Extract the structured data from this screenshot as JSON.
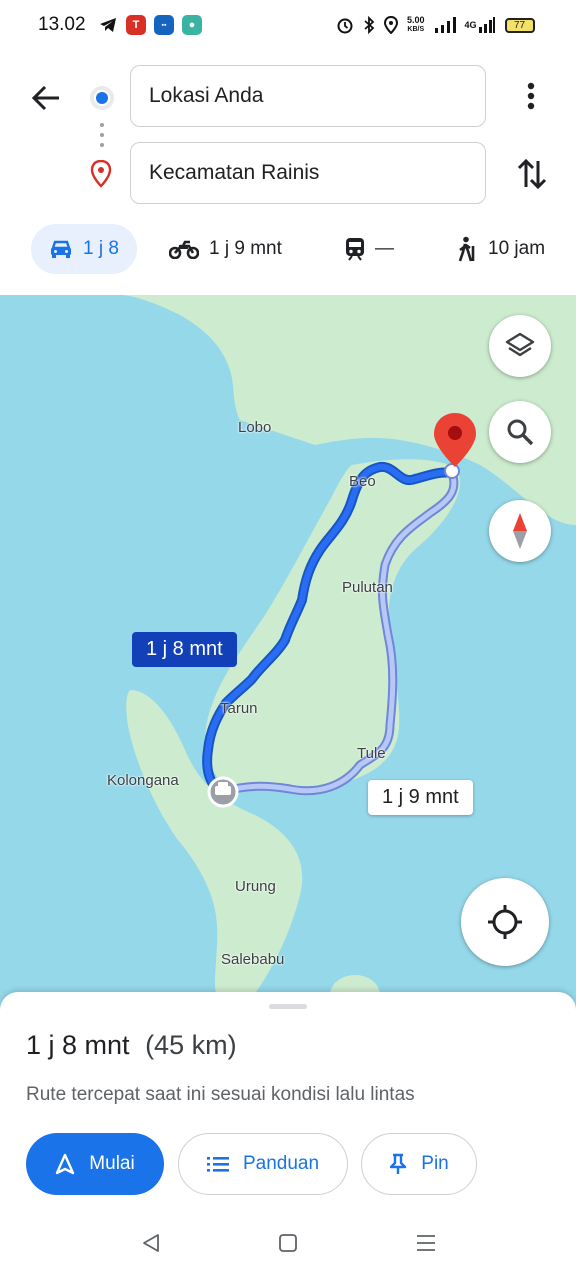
{
  "status_bar": {
    "time": "13.02",
    "speed_value": "5.00",
    "speed_unit": "KB/S",
    "network": "4G",
    "battery": "77"
  },
  "header": {
    "origin": "Lokasi Anda",
    "destination": "Kecamatan Rainis"
  },
  "modes": [
    {
      "name": "car",
      "label": "1 j 8"
    },
    {
      "name": "motorcycle",
      "label": "1 j 9 mnt"
    },
    {
      "name": "transit",
      "label": "—"
    },
    {
      "name": "walk",
      "label": "10 jam"
    }
  ],
  "map": {
    "places": [
      "Lobo",
      "Beo",
      "Pulutan",
      "Tarun",
      "Kolongana",
      "Tule",
      "Urung",
      "Salebabu"
    ],
    "route_primary_time": "1 j 8 mnt",
    "route_alt_time": "1 j 9 mnt",
    "colors": {
      "water": "#95d8ea",
      "land": "#cdeccf",
      "route": "#1a73e8",
      "route_alt": "#aabdf5",
      "pin": "#ea4335"
    }
  },
  "sheet": {
    "duration": "1 j 8 mnt",
    "distance": "(45 km)",
    "description": "Rute tercepat saat ini sesuai kondisi lalu lintas",
    "start_label": "Mulai",
    "guide_label": "Panduan",
    "pin_label": "Pin"
  }
}
